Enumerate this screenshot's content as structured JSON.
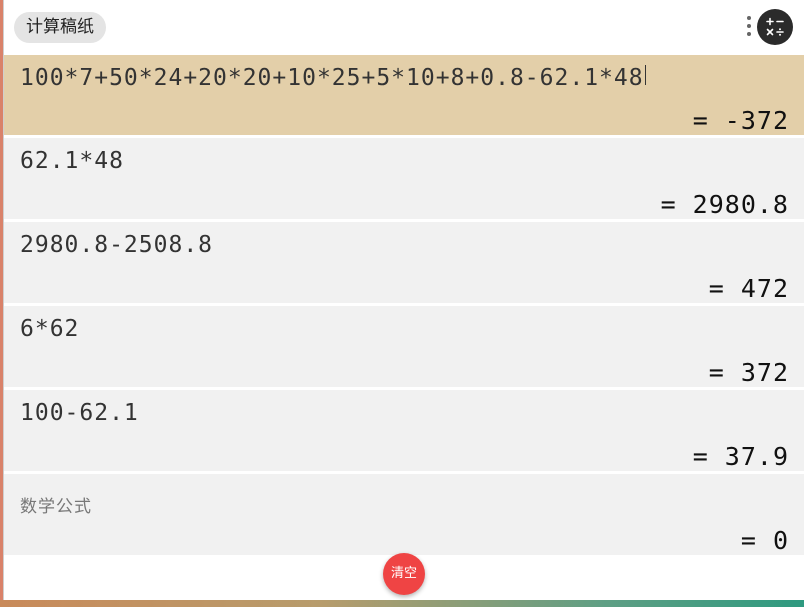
{
  "app": {
    "title": "计算稿纸",
    "clear_label": "清空"
  },
  "icons": {
    "menu": "more-vert-icon",
    "calculator": "calculator-operators-icon"
  },
  "colors": {
    "active_row": "#e3cfa9",
    "row": "#f1f1f1",
    "clear_button": "#ef4444"
  },
  "rows": [
    {
      "expression": "100*7+50*24+20*20+10*25+5*10+8+0.8-62.1*48",
      "result": "= -372",
      "active": true
    },
    {
      "expression": "62.1*48",
      "result": "= 2980.8"
    },
    {
      "expression": "2980.8-2508.8",
      "result": "= 472"
    },
    {
      "expression": "6*62",
      "result": "= 372"
    },
    {
      "expression": "100-62.1",
      "result": "= 37.9"
    },
    {
      "placeholder": "数学公式",
      "result": "= 0"
    }
  ]
}
